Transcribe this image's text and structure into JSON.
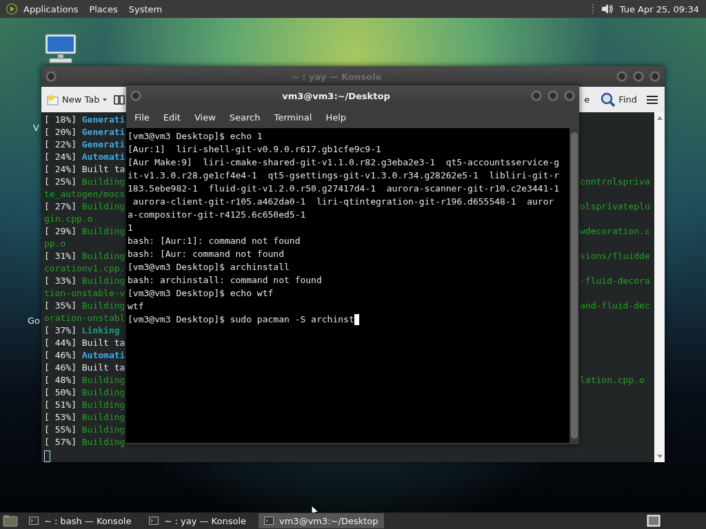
{
  "top_panel": {
    "menus": [
      "Applications",
      "Places",
      "System"
    ],
    "clock": "Tue Apr 25, 09:34"
  },
  "desktop": {
    "labels": [
      {
        "text": "V",
        "kind": "upper"
      },
      {
        "text": "Go",
        "kind": "lower"
      }
    ]
  },
  "back_window": {
    "title": "~ : yay — Konsole",
    "toolbar": {
      "new_tab": "New Tab",
      "partial": "e",
      "find": "Find"
    },
    "lines": [
      {
        "prefix": "[ 18%] ",
        "text": "Generati",
        "kind": "info"
      },
      {
        "prefix": "[ 20%] ",
        "text": "Generati",
        "kind": "info"
      },
      {
        "prefix": "[ 22%] ",
        "text": "Generati",
        "kind": "info"
      },
      {
        "prefix": "[ 24%] ",
        "text": "Automati",
        "kind": "info"
      },
      {
        "prefix": "[ 24%] ",
        "text": "Built ta",
        "kind": "plain"
      },
      {
        "prefix": "[ 25%] ",
        "text": "Building",
        "kind": "build",
        "right": "controlspriva"
      },
      {
        "text": "te_autogen/mocs",
        "kind": "build"
      },
      {
        "prefix": "[ 27%] ",
        "text": "Building",
        "kind": "build",
        "right": "olsprivateplu"
      },
      {
        "text": "gin.cpp.o",
        "kind": "build"
      },
      {
        "prefix": "[ 29%] ",
        "text": "Building",
        "kind": "build",
        "right": "wdecoration.c"
      },
      {
        "text": "pp.o",
        "kind": "build"
      },
      {
        "prefix": "[ 31%] ",
        "text": "Building",
        "kind": "build",
        "right": "sions/fluidde"
      },
      {
        "text": "corationv1.cpp.",
        "kind": "build"
      },
      {
        "prefix": "[ 33%] ",
        "text": "Building",
        "kind": "build",
        "right": "-fluid-decora"
      },
      {
        "text": "tion-unstable-v",
        "kind": "build"
      },
      {
        "prefix": "[ 35%] ",
        "text": "Building",
        "kind": "build",
        "right": "and-fluid-dec"
      },
      {
        "text": "oration-unstabl",
        "kind": "build"
      },
      {
        "prefix": "[ 37%] ",
        "text": "Linking",
        "kind": "link"
      },
      {
        "prefix": "[ 44%] ",
        "text": "Built ta",
        "kind": "plain"
      },
      {
        "prefix": "[ 46%] ",
        "text": "Automati",
        "kind": "info"
      },
      {
        "prefix": "[ 46%] ",
        "text": "Built ta",
        "kind": "plain"
      },
      {
        "prefix": "[ 48%] ",
        "text": "Building",
        "kind": "build",
        "right": "lation.cpp.o"
      },
      {
        "prefix": "[ 50%] ",
        "text": "Building",
        "kind": "build"
      },
      {
        "prefix": "[ 51%] ",
        "text": "Building",
        "kind": "build"
      },
      {
        "prefix": "[ 53%] ",
        "text": "Building",
        "kind": "build"
      },
      {
        "prefix": "[ 55%] ",
        "text": "Building",
        "kind": "build"
      },
      {
        "prefix": "[ 57%] ",
        "text": "Building",
        "kind": "build"
      }
    ]
  },
  "front_window": {
    "title": "vm3@vm3:~/Desktop",
    "menus": [
      "File",
      "Edit",
      "View",
      "Search",
      "Terminal",
      "Help"
    ],
    "lines": [
      "[vm3@vm3 Desktop]$ echo 1",
      "[Aur:1]  liri-shell-git-v0.9.0.r617.gb1cfe9c9-1",
      "[Aur Make:9]  liri-cmake-shared-git-v1.1.0.r82.g3eba2e3-1  qt5-accountsservice-g",
      "it-v1.3.0.r28.ge1cf4e4-1  qt5-gsettings-git-v1.3.0.r34.g28262e5-1  libliri-git-r",
      "183.5ebe982-1  fluid-git-v1.2.0.r50.g27417d4-1  aurora-scanner-git-r10.c2e3441-1",
      " aurora-client-git-r105.a462da0-1  liri-qtintegration-git-r196.d655548-1  auror",
      "a-compositor-git-r4125.6c650ed5-1",
      "1",
      "bash: [Aur:1]: command not found",
      "bash: [Aur: command not found",
      "[vm3@vm3 Desktop]$ archinstall",
      "bash: archinstall: command not found",
      "[vm3@vm3 Desktop]$ echo wtf",
      "wtf",
      "[vm3@vm3 Desktop]$ sudo pacman -S archinst"
    ]
  },
  "taskbar": {
    "tasks": [
      {
        "label": "~ : bash — Konsole",
        "selected": false
      },
      {
        "label": "~ : yay — Konsole",
        "selected": false
      },
      {
        "label": "vm3@vm3:~/Desktop",
        "selected": true
      }
    ]
  }
}
